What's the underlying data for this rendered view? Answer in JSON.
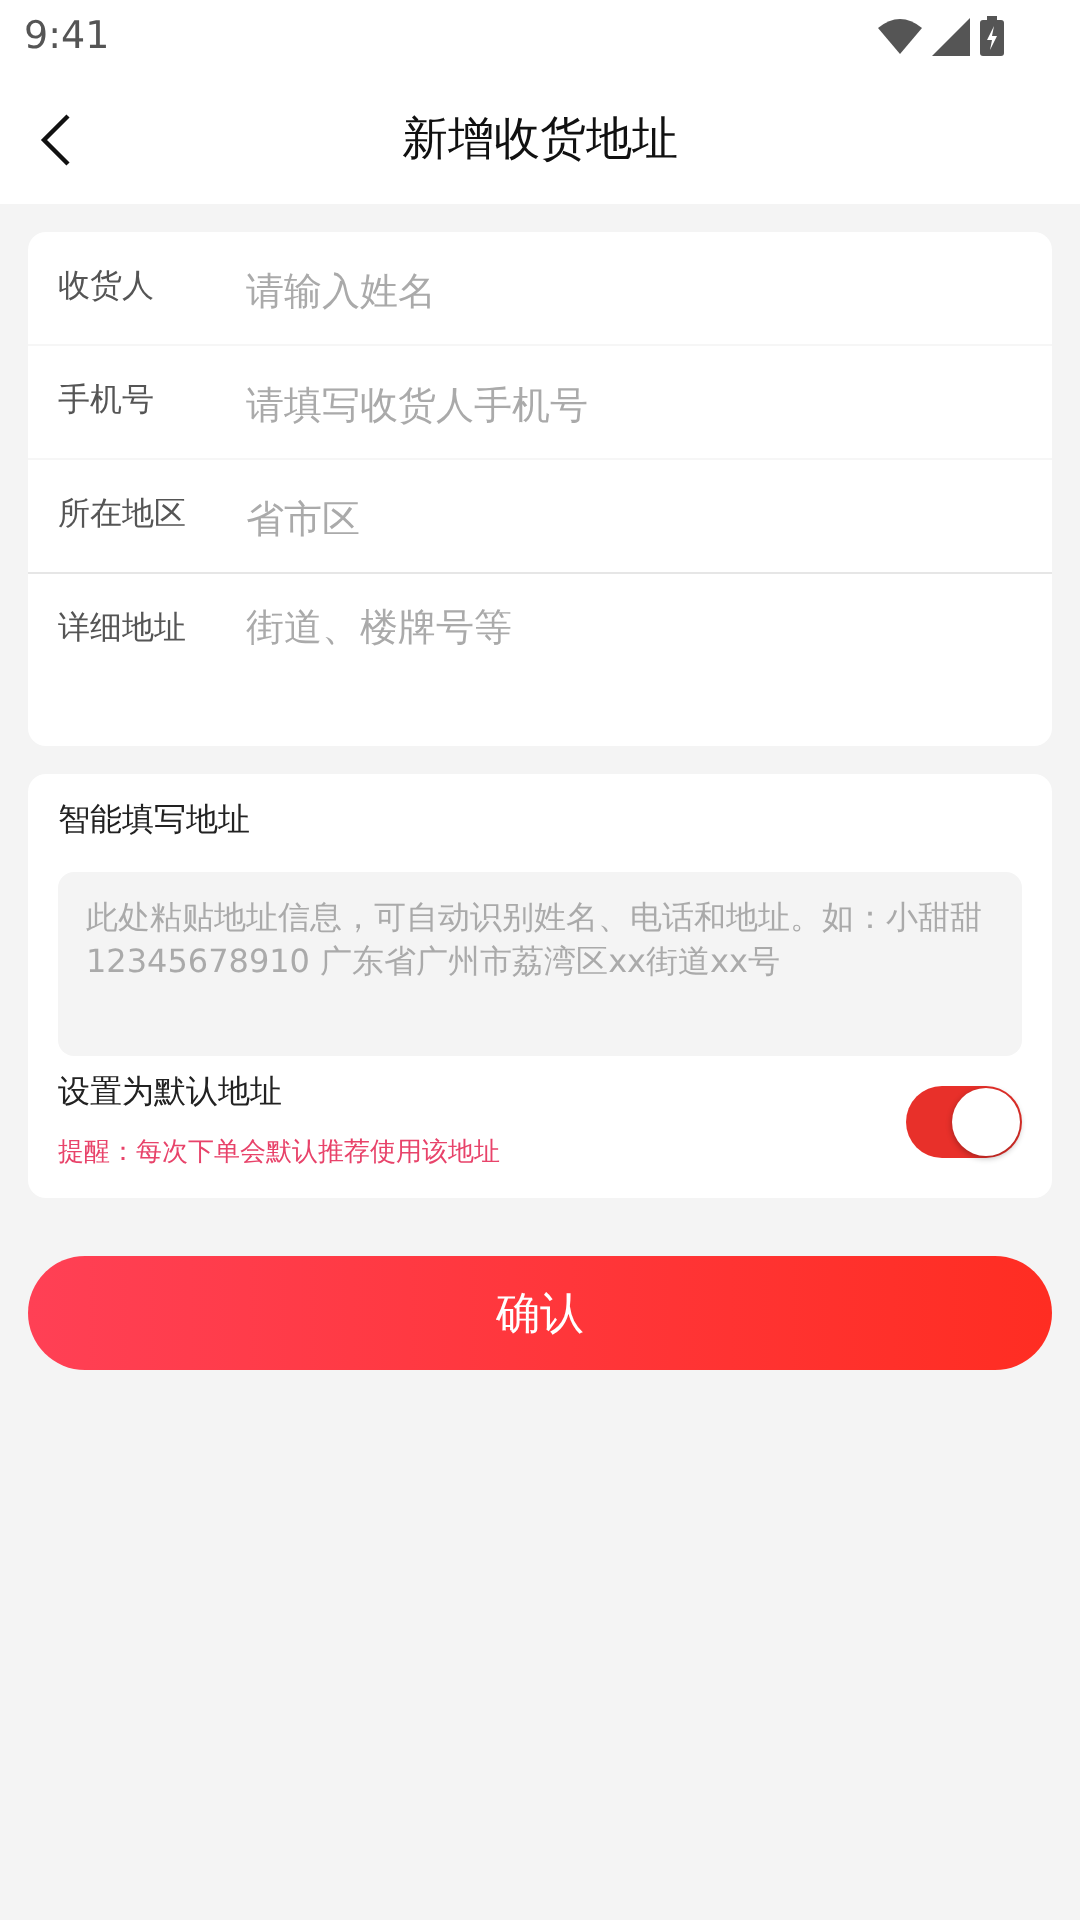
{
  "status_bar": {
    "time": "9:41"
  },
  "header": {
    "title": "新增收货地址"
  },
  "form_fields": [
    {
      "label": "收货人",
      "placeholder": "请输入姓名",
      "kind": "input"
    },
    {
      "label": "手机号",
      "placeholder": "请填写收货人手机号",
      "kind": "input"
    },
    {
      "label": "所在地区",
      "placeholder": "省市区",
      "kind": "picker"
    },
    {
      "label": "详细地址",
      "placeholder": "街道、楼牌号等",
      "kind": "textarea"
    }
  ],
  "smart_fill": {
    "title": "智能填写地址",
    "placeholder": "此处粘贴地址信息，可自动识别姓名、电话和地址。如：小甜甜 12345678910 广东省广州市荔湾区xx街道xx号"
  },
  "default_address": {
    "label": "设置为默认地址",
    "hint": "提醒：每次下单会默认推荐使用该地址",
    "on": true
  },
  "confirm_button": {
    "label": "确认"
  }
}
